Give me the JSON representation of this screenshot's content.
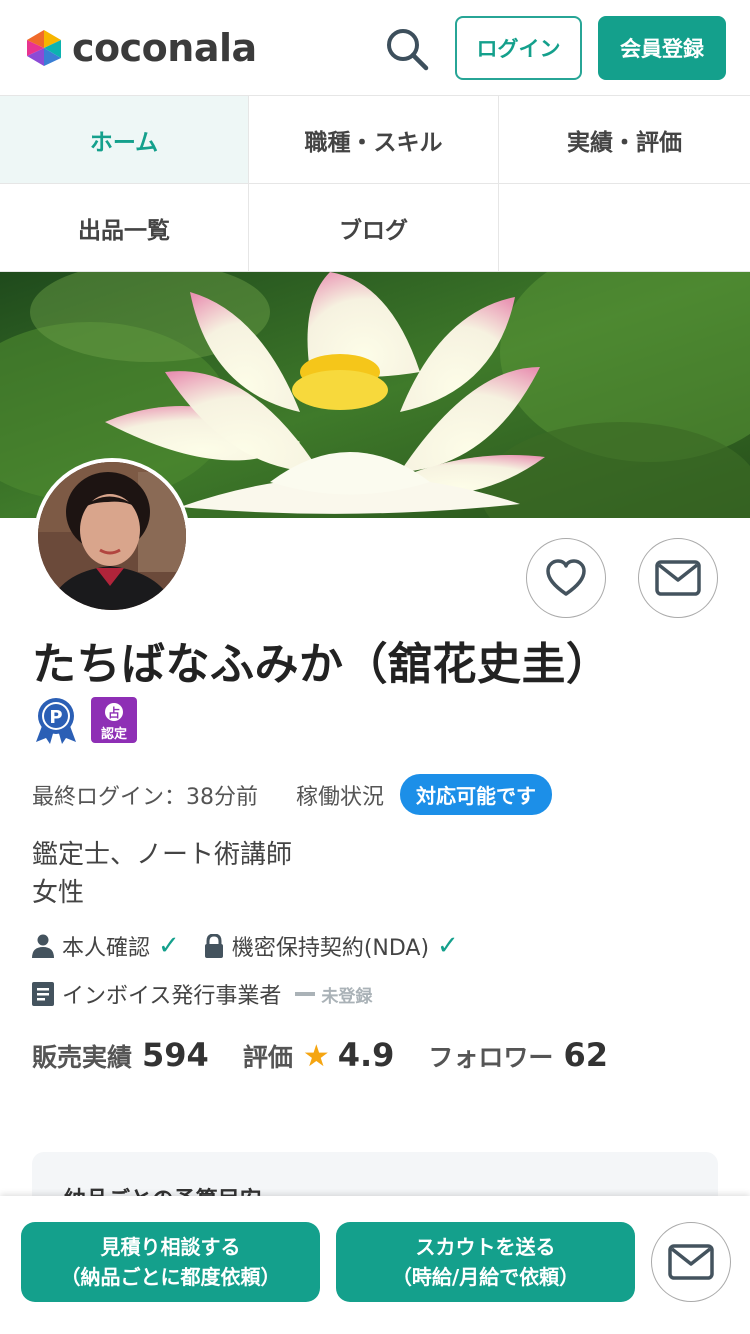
{
  "header": {
    "logo_text": "coconala",
    "login_label": "ログイン",
    "signup_label": "会員登録"
  },
  "tabs": [
    {
      "label": "ホーム",
      "active": true
    },
    {
      "label": "職種・スキル",
      "active": false
    },
    {
      "label": "実績・評価",
      "active": false
    },
    {
      "label": "出品一覧",
      "active": false
    },
    {
      "label": "ブログ",
      "active": false
    }
  ],
  "profile": {
    "name": "たちばなふみか（舘花史圭）",
    "badges": [
      "p-award-icon",
      "fortune-certified-icon"
    ],
    "badge_text": {
      "top": "占",
      "bottom": "認定"
    },
    "last_login_label": "最終ログイン：",
    "last_login_value": "38分前",
    "status_label": "稼働状況",
    "status_chip": "対応可能です",
    "occupation": "鑑定士、ノート術講師",
    "gender": "女性",
    "identity_label": "本人確認",
    "nda_label": "機密保持契約(NDA)",
    "invoice_label": "インボイス発行事業者",
    "invoice_status": "未登録"
  },
  "stats": {
    "sales_label": "販売実績",
    "sales_value": "594",
    "rating_label": "評価",
    "rating_value": "4.9",
    "followers_label": "フォロワー",
    "followers_value": "62"
  },
  "section": {
    "title": "納品ごとの予算目安"
  },
  "bottom_bar": {
    "cta1_line1": "見積り相談する",
    "cta1_line2": "（納品ごとに都度依頼）",
    "cta2_line1": "スカウトを送る",
    "cta2_line2": "（時給/月給で依頼）"
  },
  "colors": {
    "accent": "#14a08c",
    "status_blue": "#1c8fe8",
    "star": "#f5a511"
  }
}
